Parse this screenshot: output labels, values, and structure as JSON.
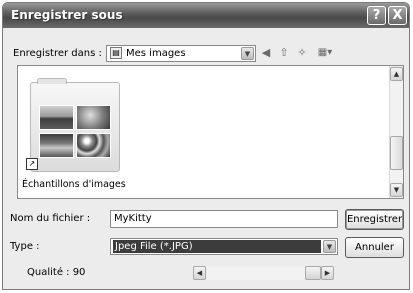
{
  "window": {
    "title": "Enregistrer sous",
    "help_glyph": "?",
    "close_glyph": "X"
  },
  "save_in": {
    "label": "Enregistrer dans :",
    "value": "Mes images"
  },
  "files": [
    {
      "name": "Échantillons d'images",
      "type": "folder-shortcut"
    }
  ],
  "filename": {
    "label": "Nom du fichier :",
    "value": "MyKitty"
  },
  "filetype": {
    "label": "Type :",
    "value": "Jpeg File (*.JPG)"
  },
  "quality": {
    "label": "Qualité : 90",
    "value": 90
  },
  "buttons": {
    "save": "Enregistrer",
    "cancel": "Annuler"
  }
}
